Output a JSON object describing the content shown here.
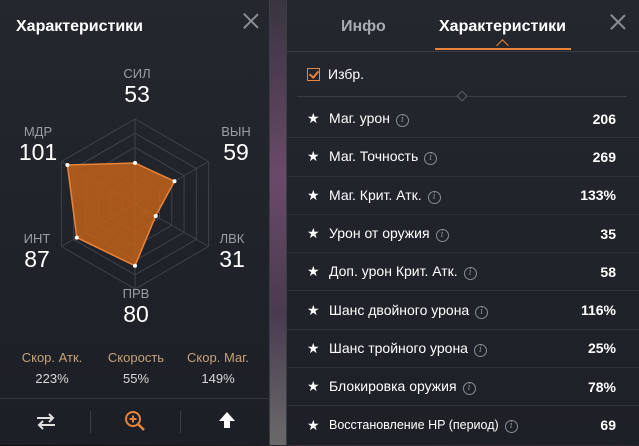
{
  "left_panel": {
    "title": "Характеристики",
    "stats": {
      "sil": {
        "label": "СИЛ",
        "value": "53"
      },
      "vyn": {
        "label": "ВЫН",
        "value": "59"
      },
      "lvk": {
        "label": "ЛВК",
        "value": "31"
      },
      "prv": {
        "label": "ПРВ",
        "value": "80"
      },
      "int": {
        "label": "ИНТ",
        "value": "87"
      },
      "mdr": {
        "label": "МДР",
        "value": "101"
      }
    },
    "radar_fill_color": "#c2611a",
    "radar_stroke_color": "#e8833a",
    "secondary": [
      {
        "name": "Скор. Атк.",
        "value": "223%"
      },
      {
        "name": "Скорость",
        "value": "55%"
      },
      {
        "name": "Скор. Маг.",
        "value": "149%"
      }
    ],
    "bottom_icons": [
      "swap-arrows-icon",
      "zoom-in-icon",
      "upload-arrow-icon"
    ]
  },
  "right_panel": {
    "tabs": [
      {
        "label": "Инфо",
        "active": false
      },
      {
        "label": "Характеристики",
        "active": true
      }
    ],
    "favorites_label": "Избр.",
    "favorites_checked": true,
    "accent_color": "#e8833a",
    "rows": [
      {
        "name": "Маг. урон",
        "value": "206"
      },
      {
        "name": "Маг. Точность",
        "value": "269"
      },
      {
        "name": "Маг. Крит. Атк.",
        "value": "133%"
      },
      {
        "name": "Урон от оружия",
        "value": "35"
      },
      {
        "name": "Доп. урон Крит. Атк.",
        "value": "58"
      },
      {
        "name": "Шанс двойного урона",
        "value": "116%"
      },
      {
        "name": "Шанс тройного урона",
        "value": "25%"
      },
      {
        "name": "Блокировка оружия",
        "value": "78%"
      },
      {
        "name": "Восстановление HP (период)",
        "value": "69"
      }
    ]
  }
}
